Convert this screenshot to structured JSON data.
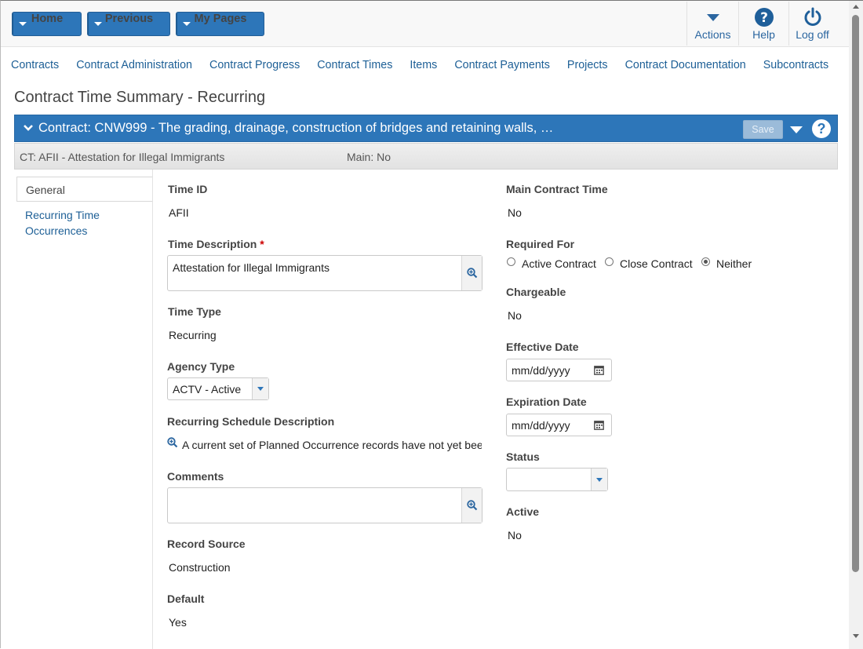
{
  "topnav": {
    "home": "Home",
    "previous": "Previous",
    "my_pages": "My Pages",
    "actions": "Actions",
    "help": "Help",
    "logoff": "Log off"
  },
  "menu": [
    "Contracts",
    "Contract Administration",
    "Contract Progress",
    "Contract Times",
    "Items",
    "Contract Payments",
    "Projects",
    "Contract Documentation",
    "Subcontracts"
  ],
  "page_title": "Contract Time Summary - Recurring",
  "contract_band": {
    "text": "Contract: CNW999 - The grading, drainage, construction of bridges and retaining walls, …",
    "save": "Save",
    "help": "?"
  },
  "subband": {
    "ct": "CT: AFII - Attestation for Illegal Immigrants",
    "main": "Main: No"
  },
  "tabs": {
    "general": "General",
    "recurring_line1": "Recurring Time",
    "recurring_line2": "Occurrences"
  },
  "left_col": {
    "time_id_label": "Time ID",
    "time_id_value": "AFII",
    "time_desc_label": "Time Description",
    "required_marker": "*",
    "time_desc_value": "Attestation for Illegal Immigrants",
    "time_type_label": "Time Type",
    "time_type_value": "Recurring",
    "agency_type_label": "Agency Type",
    "agency_type_value": "ACTV - Active",
    "recurring_sched_label": "Recurring Schedule Description",
    "recurring_sched_value": "A current set of Planned Occurrence records have not yet bee",
    "comments_label": "Comments",
    "comments_value": "",
    "record_source_label": "Record Source",
    "record_source_value": "Construction",
    "default_label": "Default",
    "default_value": "Yes"
  },
  "right_col": {
    "main_contract_time_label": "Main Contract Time",
    "main_contract_time_value": "No",
    "required_for_label": "Required For",
    "required_for_options": [
      "Active Contract",
      "Close Contract",
      "Neither"
    ],
    "required_for_selected": "Neither",
    "chargeable_label": "Chargeable",
    "chargeable_value": "No",
    "effective_date_label": "Effective Date",
    "effective_date_placeholder": "mm/dd/yyyy",
    "expiration_date_label": "Expiration Date",
    "expiration_date_placeholder": "mm/dd/yyyy",
    "status_label": "Status",
    "status_value": "",
    "active_label": "Active",
    "active_value": "No"
  },
  "colors": {
    "primary": "#2d76b9",
    "link": "#1d5f96",
    "required": "#cc0000"
  }
}
